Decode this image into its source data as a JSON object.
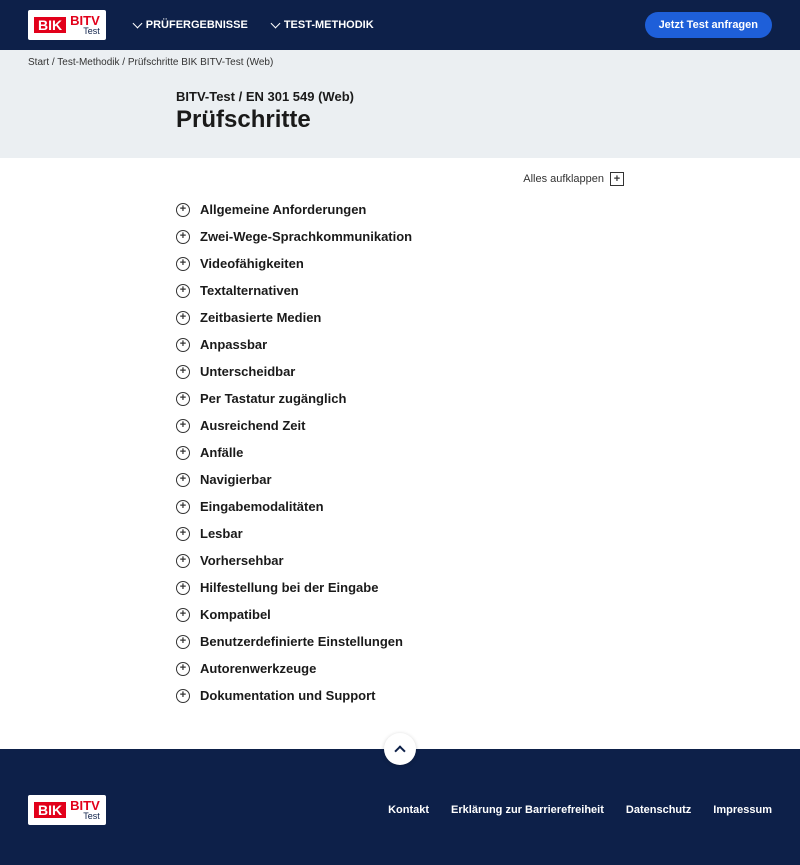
{
  "logo": {
    "bik": "BIK",
    "bitv": "BITV",
    "test": "Test"
  },
  "nav": [
    {
      "label": "PRÜFERGEBNISSE"
    },
    {
      "label": "TEST-METHODIK"
    }
  ],
  "cta": "Jetzt Test anfragen",
  "breadcrumbs": [
    {
      "label": "Start"
    },
    {
      "label": "Test-Methodik"
    },
    {
      "label": "Prüfschritte BIK BITV-Test (Web)"
    }
  ],
  "pretitle": "BITV-Test / EN 301 549 (Web)",
  "title": "Prüfschritte",
  "expand_all": "Alles aufklappen",
  "items": [
    "Allgemeine Anforderungen",
    "Zwei-Wege-Sprachkommunikation",
    "Videofähigkeiten",
    "Textalternativen",
    "Zeitbasierte Medien",
    "Anpassbar",
    "Unterscheidbar",
    "Per Tastatur zugänglich",
    "Ausreichend Zeit",
    "Anfälle",
    "Navigierbar",
    "Eingabemodalitäten",
    "Lesbar",
    "Vorhersehbar",
    "Hilfestellung bei der Eingabe",
    "Kompatibel",
    "Benutzerdefinierte Einstellungen",
    "Autorenwerkzeuge",
    "Dokumentation und Support"
  ],
  "footer": [
    "Kontakt",
    "Erklärung zur Barrierefreiheit",
    "Datenschutz",
    "Impressum"
  ]
}
